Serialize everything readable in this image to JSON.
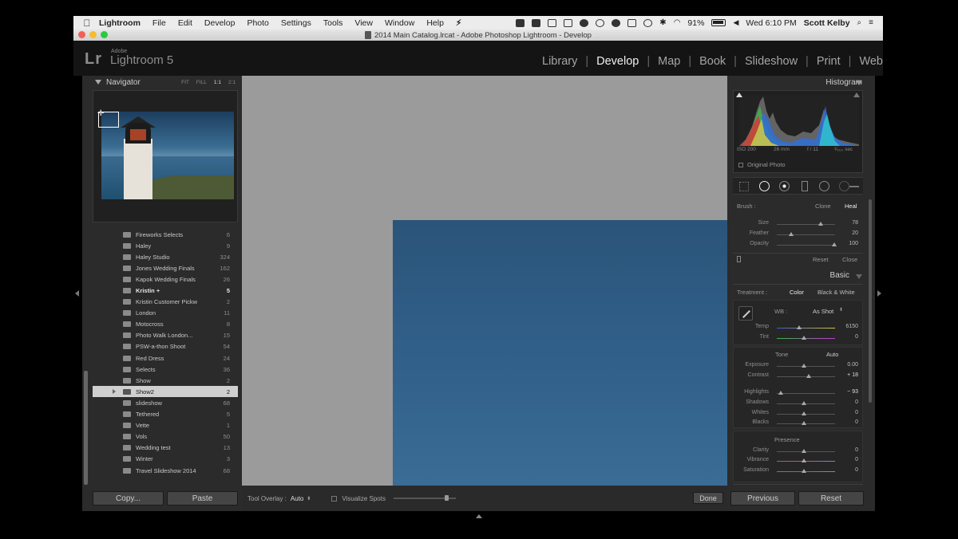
{
  "menubar": {
    "items": [
      "Lightroom",
      "File",
      "Edit",
      "Develop",
      "Photo",
      "Settings",
      "Tools",
      "View",
      "Window",
      "Help"
    ],
    "battery": "91%",
    "clock": "Wed 6:10 PM",
    "user": "Scott Kelby"
  },
  "window": {
    "title": "2014 Main Catalog.lrcat - Adobe Photoshop Lightroom - Develop"
  },
  "app": {
    "logo": "Lr",
    "vendor": "Adobe",
    "name": "Lightroom 5"
  },
  "modules": [
    "Library",
    "Develop",
    "Map",
    "Book",
    "Slideshow",
    "Print",
    "Web"
  ],
  "navigator": {
    "title": "Navigator",
    "zooms": [
      "FIT",
      "FILL",
      "1:1",
      "2:1"
    ]
  },
  "folders": [
    {
      "name": "Fireworks Selects",
      "count": "6"
    },
    {
      "name": "Haley",
      "count": "9"
    },
    {
      "name": "Haley Studio",
      "count": "324"
    },
    {
      "name": "Jones Wedding Finals",
      "count": "162"
    },
    {
      "name": "Kapok Wedding Finals",
      "count": "26"
    },
    {
      "name": "Kristin  +",
      "count": "5"
    },
    {
      "name": "Kristin Customer Pickw",
      "count": "2"
    },
    {
      "name": "London",
      "count": "11"
    },
    {
      "name": "Motocross",
      "count": "8"
    },
    {
      "name": "Photo Walk London...",
      "count": "15"
    },
    {
      "name": "PSW-a-thon Shoot",
      "count": "54"
    },
    {
      "name": "Red Dress",
      "count": "24"
    },
    {
      "name": "Selects",
      "count": "36"
    },
    {
      "name": "Show",
      "count": "2"
    },
    {
      "name": "Show2",
      "count": "2"
    },
    {
      "name": "slideshow",
      "count": "68"
    },
    {
      "name": "Tethered",
      "count": "5"
    },
    {
      "name": "Vette",
      "count": "1"
    },
    {
      "name": "Vols",
      "count": "50"
    },
    {
      "name": "Wedding test",
      "count": "13"
    },
    {
      "name": "Winter",
      "count": "3"
    },
    {
      "name": "Travel Slideshow 2014",
      "count": "68"
    }
  ],
  "left_buttons": {
    "copy": "Copy...",
    "paste": "Paste"
  },
  "toolbar": {
    "overlay_label": "Tool Overlay :",
    "overlay_value": "Auto",
    "visualize": "Visualize Spots",
    "done": "Done"
  },
  "histogram": {
    "title": "Histogram",
    "iso": "ISO 200",
    "focal": "26 mm",
    "aperture": "f / 11",
    "shutter": "¹⁄₅₀₀ sec",
    "original": "Original Photo"
  },
  "brush": {
    "label": "Brush :",
    "clone": "Clone",
    "heal": "Heal",
    "size_label": "Size",
    "size": "78",
    "feather_label": "Feather",
    "feather": "20",
    "opacity_label": "Opacity",
    "opacity": "100",
    "reset": "Reset",
    "close": "Close"
  },
  "basic": {
    "title": "Basic",
    "treatment_label": "Treatment :",
    "color": "Color",
    "bw": "Black & White",
    "wb_label": "WB :",
    "wb_value": "As Shot",
    "temp_label": "Temp",
    "temp": "6150",
    "tint_label": "Tint",
    "tint": "0",
    "tone": "Tone",
    "auto": "Auto",
    "exposure_label": "Exposure",
    "exposure": "0.00",
    "contrast_label": "Contrast",
    "contrast": "+ 18",
    "highlights_label": "Highlights",
    "highlights": "− 93",
    "shadows_label": "Shadows",
    "shadows": "0",
    "whites_label": "Whites",
    "whites": "0",
    "blacks_label": "Blacks",
    "blacks": "0",
    "presence": "Presence",
    "clarity_label": "Clarity",
    "clarity": "0",
    "vibrance_label": "Vibrance",
    "vibrance": "0",
    "saturation_label": "Saturation",
    "saturation": "0"
  },
  "right_buttons": {
    "previous": "Previous",
    "reset": "Reset"
  }
}
